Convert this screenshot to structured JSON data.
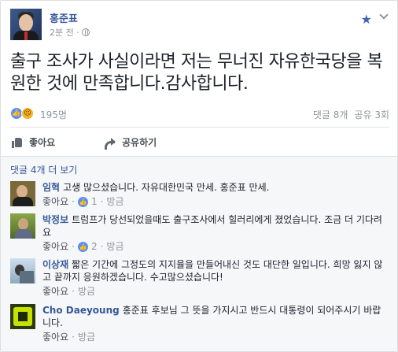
{
  "post": {
    "author": "홍준표",
    "time": "2분 전 ·",
    "text": "출구 조사가 사실이라면 저는 무너진 자유한국당을 복원한 것에 만족합니다.감사합니다.",
    "reaction_count": "195명",
    "comments_count": "댓글 8개",
    "shares_count": "공유 3회"
  },
  "actions": {
    "like_label": "좋아요",
    "share_label": "공유하기"
  },
  "comments_section": {
    "more_label": "댓글 4개 더 보기",
    "items": [
      {
        "name": "임혁",
        "text": "고생 많으셨습니다. 자유대한민국 만세. 홍준표 만세.",
        "like": "좋아요",
        "sep": "·",
        "likes": "1",
        "time": "방금"
      },
      {
        "name": "박정보",
        "text": "트럼프가 당선되었을때도 출구조사에서 힐러리에게 졌었습니다. 조금 더 기다려요",
        "like": "좋아요",
        "sep": "·",
        "likes": "2",
        "time": "방금"
      },
      {
        "name": "이상재",
        "text": "짧은 기간에 그정도의 지지율을 만들어내신 것도 대단한 일입니다. 희망 잃지 않고 끝까지 응원하겠습니다. 수고많으셨습니다!",
        "like": "좋아요",
        "sep": "·",
        "time": "방금"
      },
      {
        "name": "Cho Daeyoung",
        "text": "홍준표 후보님 그 뜻을 가지시고 반드시 대통령이 되어주시기 바랍니다.",
        "like": "좋아요",
        "sep": "·",
        "time": "방금"
      }
    ]
  },
  "colors": {
    "link": "#365899",
    "muted": "#90949c",
    "accent": "#4267b2"
  }
}
